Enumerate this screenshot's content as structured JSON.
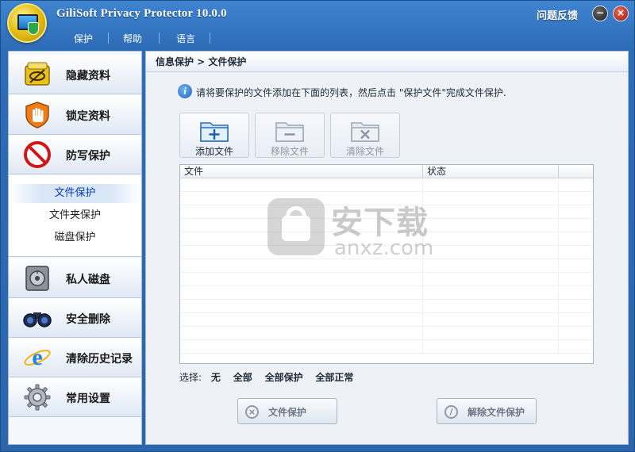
{
  "window": {
    "title": "GiliSoft Privacy Protector 10.0.0",
    "feedback_label": "问题反馈"
  },
  "menu": {
    "items": [
      {
        "label": "保护"
      },
      {
        "label": "帮助"
      },
      {
        "label": "语言"
      }
    ]
  },
  "sidebar": {
    "items": [
      {
        "label": "隐藏资料",
        "icon": "hide-data-icon"
      },
      {
        "label": "锁定资料",
        "icon": "lock-hand-icon"
      },
      {
        "label": "防写保护",
        "icon": "no-entry-icon"
      },
      {
        "label": "私人磁盘",
        "icon": "safe-disk-icon"
      },
      {
        "label": "安全删除",
        "icon": "binoculars-icon"
      },
      {
        "label": "清除历史记录",
        "icon": "browser-e-icon"
      },
      {
        "label": "常用设置",
        "icon": "gear-icon"
      }
    ],
    "subitems": [
      {
        "label": "文件保护",
        "active": true
      },
      {
        "label": "文件夹保护",
        "active": false
      },
      {
        "label": "磁盘保护",
        "active": false
      }
    ]
  },
  "main": {
    "breadcrumb": "信息保护 > 文件保护",
    "info_text": "请将要保护的文件添加在下面的列表，然后点击 \"保护文件\"完成文件保护.",
    "toolbar": {
      "add": "添加文件",
      "remove": "移除文件",
      "clear": "清除文件"
    },
    "table": {
      "columns": [
        "文件",
        "状态"
      ],
      "rows": []
    },
    "watermark": {
      "text": "安下载",
      "url": "anxz.com"
    },
    "select": {
      "label": "选择:",
      "options": [
        "无",
        "全部",
        "全部保护",
        "全部正常"
      ]
    },
    "actions": {
      "protect": "文件保护",
      "unprotect": "解除文件保护"
    }
  }
}
